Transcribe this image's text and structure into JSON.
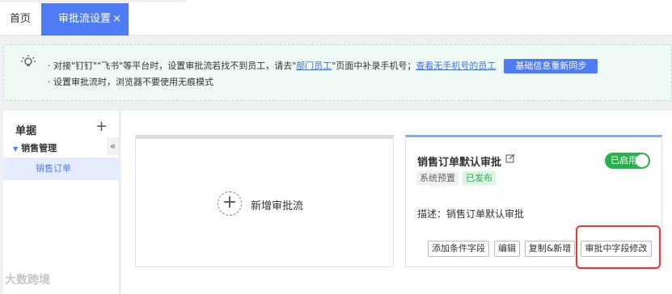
{
  "tabs": {
    "home": "首页",
    "active": "审批流设置",
    "close_symbol": "×"
  },
  "notice": {
    "line1_prefix": "· 对接\"钉钉\"\"飞书\"等平台时，设置审批流若找不到员工，请去\"",
    "dept_link": "部门员工",
    "line1_mid": "\"页面中补录手机号；",
    "no_phone_link": "查看无手机号的员工",
    "sync_button": "基础信息重新同步",
    "line2": "· 设置审批流时，浏览器不要使用无痕模式"
  },
  "sidebar": {
    "title": "单据",
    "add_symbol": "+",
    "collapse_symbol": "«",
    "group": "销售管理",
    "leaf": "销售订单"
  },
  "main": {
    "new_flow_label": "新增审批流",
    "flow": {
      "name": "销售订单默认审批",
      "toggle_label": "已启用",
      "tag_system": "系统预置",
      "tag_published": "已发布",
      "description": "描述：销售订单默认审批",
      "actions": [
        "添加条件字段",
        "编辑",
        "复制&新增",
        "审批中字段修改"
      ]
    }
  },
  "watermark": "大数跨境",
  "colors": {
    "primary": "#4d7cf5",
    "success": "#27b14a",
    "highlight": "#e53935"
  }
}
